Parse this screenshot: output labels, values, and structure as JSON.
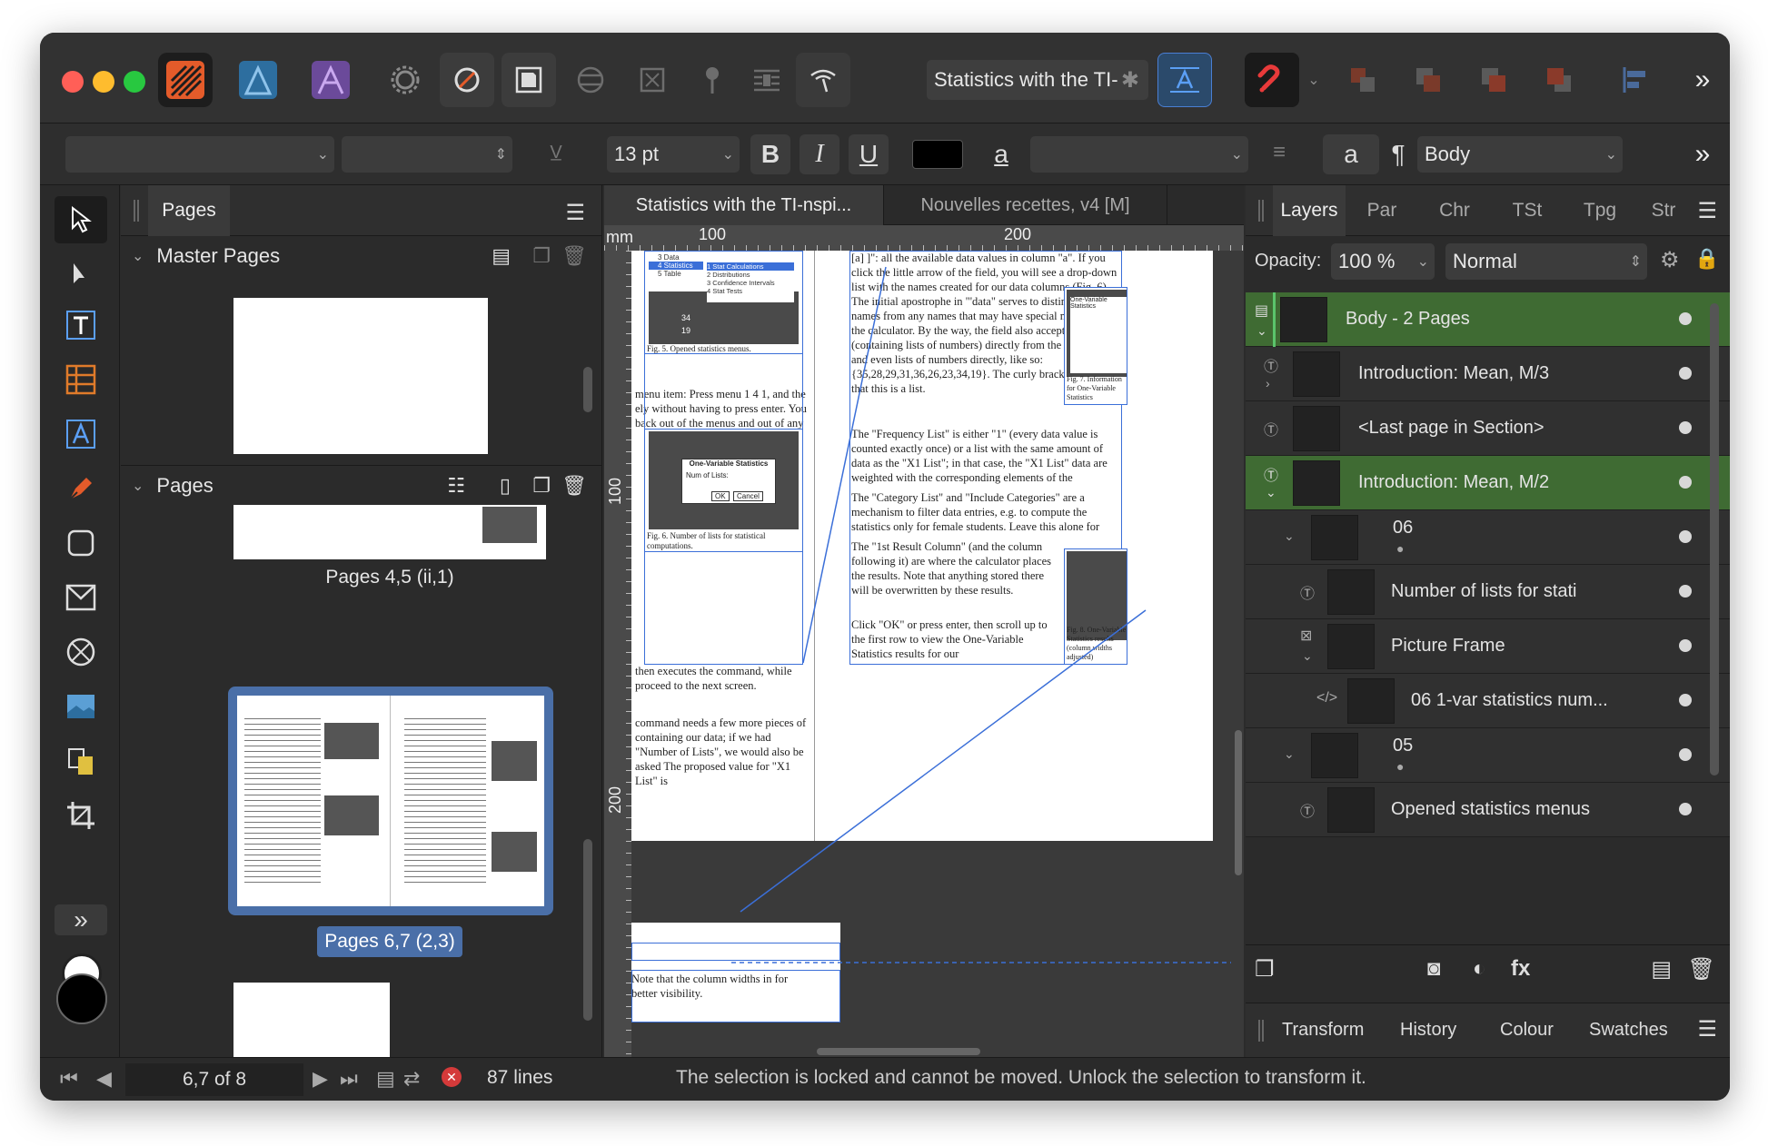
{
  "toolbar": {
    "document_title": "Statistics with the TI-",
    "brand_colors": {
      "publisher": "#e45b2a",
      "designer": "#2d6e9f",
      "photo": "#6b4a9a"
    }
  },
  "context_bar": {
    "font_size": "13 pt",
    "bold": "B",
    "italic": "I",
    "underline": "U",
    "text_style_glyph": "a",
    "char_glyph": "a",
    "para_glyph": "¶",
    "paragraph_style": "Body",
    "more": "»"
  },
  "pages_panel": {
    "tab_label": "Pages",
    "master_section": "Master Pages",
    "pages_section": "Pages",
    "spreads": [
      {
        "label": "Pages 4,5 (ii,1)"
      },
      {
        "label": "Pages 6,7 (2,3)"
      }
    ]
  },
  "doc_tabs": [
    {
      "label": "Statistics with the TI-nspi..."
    },
    {
      "label": "Nouvelles recettes, v4 [M]"
    }
  ],
  "ruler": {
    "unit": "mm",
    "top_ticks": [
      "100",
      "200"
    ],
    "left_ticks": [
      "100",
      "200"
    ]
  },
  "document": {
    "left_col_text": "[a] ]\": all the available data values in column \"a\". If you click the little arrow of the field, you will see a drop-down list with the names created for our data columns (Fig. 6). The initial apostrophe in \"'data\" serves to distinguish our names from any names that may have special meaning to the calculator. By the way, the field also accepts variables (containing lists of numbers) directly from the CAS side and even lists of numbers directly, like so: {35,28,29,31,36,26,23,34,19}. The curly brackets indicate that this is a list.",
    "para2": "The \"Frequency List\" is either \"1\" (every data value is counted exactly once) or a list with the same amount of data as the \"X1 List\"; in that case, the \"X1 List\" data are weighted with the corresponding elements of the \"Frequency List\".",
    "para3": "The \"Category List\" and \"Include Categories\" are a mechanism to filter data entries, e.g. to compute the statistics only for female students. Leave this alone for now.",
    "para4": "The \"1st Result Column\" (and the column following it) are where the calculator places the results. Note that anything stored there will be overwritten by these results.",
    "para5": "Click \"OK\" or press enter, then scroll up to the first row to view the One-Variable Statistics results for our",
    "mid_text1": "menu item: Press menu 1 4 1, and the ely without having to press enter. You back out of the menus and out of any",
    "mid_text2": "then executes the command, while proceed to the next screen.",
    "mid_text3": "command needs a few more pieces of containing our data; if we had \"Number of Lists\", we would also be asked The proposed value for \"X1 List\" is",
    "caption5": "Fig. 5. Opened statistics menus.",
    "caption6": "Fig. 6. Number of lists for statistical computations.",
    "caption7": "Fig. 7. Information for One-Variable Statistics",
    "caption8": "Fig. 8. One-Variable Statistics results (column widths adjusted)",
    "dialog_title": "One-Variable Statistics",
    "dialog_field": "Num of Lists:",
    "dialog_ok": "OK",
    "dialog_cancel": "Cancel",
    "menu_items": [
      "3 Data",
      "4 Statistics",
      "5 Table",
      "1 Stat Calculations",
      "2 Distributions",
      "3 Confidence Intervals",
      "4 Stat Tests"
    ],
    "menu_numbers": [
      "34",
      "19"
    ],
    "bottom_text": "Note that the column widths in for better visibility."
  },
  "layers_panel": {
    "tabs": [
      "Layers",
      "Par",
      "Chr",
      "TSt",
      "Tpg",
      "Str"
    ],
    "opacity_label": "Opacity:",
    "opacity_value": "100 %",
    "blend_mode": "Normal",
    "rows": [
      {
        "name": "Body - 2 Pages"
      },
      {
        "name": "Introduction: Mean, M/3"
      },
      {
        "name": "<Last page in Section>"
      },
      {
        "name": "Introduction: Mean, M/2"
      },
      {
        "name": "06"
      },
      {
        "name": "Number of lists for stati"
      },
      {
        "name": "Picture Frame"
      },
      {
        "name": "06 1-var statistics num..."
      },
      {
        "name": "05"
      },
      {
        "name": "Opened statistics menus"
      }
    ],
    "bottom_tabs": [
      "Transform",
      "History",
      "Colour",
      "Swatches"
    ]
  },
  "status": {
    "page_indicator": "6,7 of 8",
    "lines": "87 lines",
    "message": "The selection is locked and cannot be moved. Unlock the selection to transform it."
  },
  "colors": {
    "selection_blue": "#3b6fd8",
    "active_layer_green": "#3f6b33",
    "accent_blue": "#4a7fd4"
  }
}
